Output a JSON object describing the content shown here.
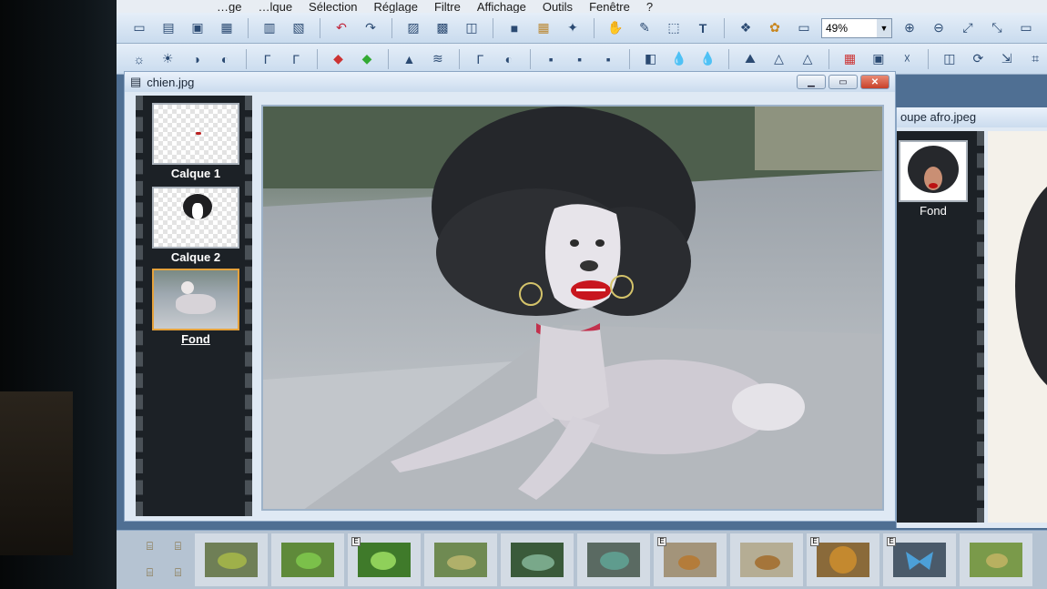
{
  "menu": [
    "…ge",
    "…lque",
    "Sélection",
    "Réglage",
    "Filtre",
    "Affichage",
    "Outils",
    "Fenêtre",
    "?"
  ],
  "toolbar": {
    "zoom_value": "49%"
  },
  "doc": {
    "title": "chien.jpg"
  },
  "layers": [
    {
      "name": "Calque 1"
    },
    {
      "name": "Calque 2"
    },
    {
      "name": "Fond"
    }
  ],
  "second_window": {
    "title": "oupe afro.jpeg",
    "layer_name": "Fond"
  },
  "browser": {
    "badge": "E"
  },
  "icons": [
    "new-icon",
    "open-icon",
    "save-icon",
    "undo-icon",
    "redo-icon",
    "text-tool-icon",
    "zoom-in-icon",
    "zoom-out-icon"
  ]
}
